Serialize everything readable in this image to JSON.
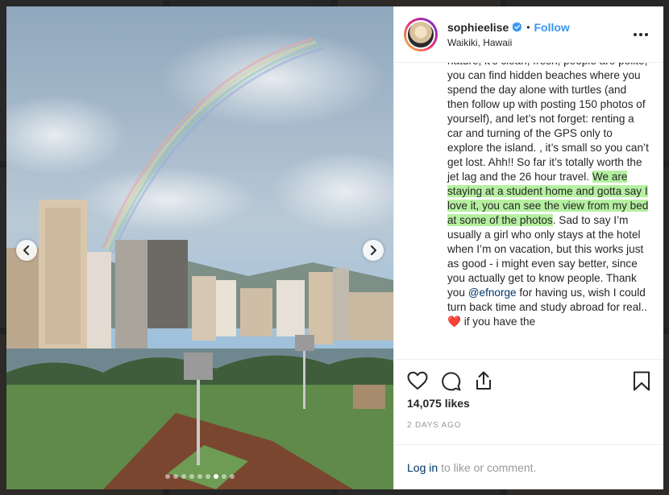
{
  "post": {
    "username": "sophieelise",
    "follow_label": "Follow",
    "bullet": "•",
    "location": "Waikiki, Hawaii",
    "caption": {
      "part1": "nature, it’s clean, fresh, people are polite, you can find hidden beaches where you spend the day alone with turtles (and then follow up with posting 150 photos of yourself), and let’s not forget: renting a car and turning of the GPS only to explore the island. , it’s small so you can’t get lost. Ahh!! So far it’s totally worth the jet lag and the 26 hour travel. ",
      "highlight": "We are staying at a student home and gotta say I love it, you can see the view from my bed at some of the photos",
      "part2": ". Sad to say I’m usually a girl who only stays at the hotel when I’m on vacation, but this works just as good - i might even say better, since you actually get to know people. Thank you ",
      "mention": "@efnorge",
      "part3": " for having us, wish I could turn back time and study abroad for real.. ",
      "emoji": "❤️",
      "part4": " if you have the"
    },
    "likes": "14,075 likes",
    "time": "2 DAYS AGO",
    "login_link": "Log in",
    "login_rest": "to like or comment."
  },
  "carousel": {
    "count": 9,
    "active_index": 6
  },
  "icons": {
    "like": "heart-icon",
    "comment": "comment-icon",
    "share": "share-icon",
    "save": "bookmark-icon",
    "more": "more-icon",
    "verified": "verified-badge-icon",
    "prev": "chevron-left-icon",
    "next": "chevron-right-icon"
  },
  "colors": {
    "accent": "#3897f0",
    "highlight": "#b5f0a0",
    "verified": "#3897f0"
  }
}
